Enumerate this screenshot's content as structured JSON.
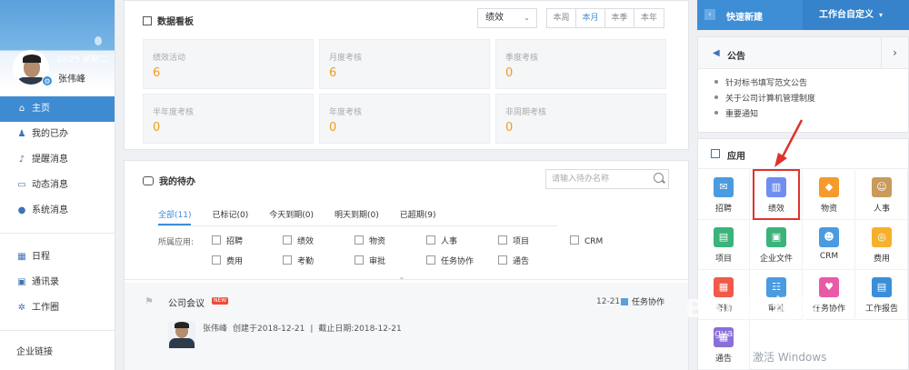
{
  "sidebar": {
    "date": "12/25 星期二",
    "user_name": "张伟峰",
    "items": [
      {
        "label": "主页",
        "icon": "home-icon",
        "active": true
      },
      {
        "label": "我的已办",
        "icon": "user-check-icon"
      },
      {
        "label": "提醒消息",
        "icon": "bell-icon"
      },
      {
        "label": "动态消息",
        "icon": "message-icon"
      },
      {
        "label": "系统消息",
        "icon": "info-icon"
      },
      {
        "label": "日程",
        "icon": "calendar-icon"
      },
      {
        "label": "通讯录",
        "icon": "contacts-icon"
      },
      {
        "label": "工作圈",
        "icon": "circle-icon"
      },
      {
        "label": "企业链接",
        "icon": ""
      }
    ]
  },
  "kanban": {
    "title": "数据看板",
    "select_value": "绩效",
    "periods": [
      "本周",
      "本月",
      "本季",
      "本年"
    ],
    "active_period": "本月",
    "cards": [
      {
        "label": "绩效活动",
        "value": "6"
      },
      {
        "label": "月度考核",
        "value": "6"
      },
      {
        "label": "季度考核",
        "value": "0"
      },
      {
        "label": "半年度考核",
        "value": "0"
      },
      {
        "label": "年度考核",
        "value": "0"
      },
      {
        "label": "非周期考核",
        "value": "0"
      }
    ]
  },
  "todo": {
    "title": "我的待办",
    "search_placeholder": "请输入待办名称",
    "tabs": [
      "全部(11)",
      "已标记(0)",
      "今天到期(0)",
      "明天到期(0)",
      "已超期(9)"
    ],
    "filter_label": "所属应用:",
    "filters": [
      "招聘",
      "绩效",
      "物资",
      "人事",
      "项目",
      "CRM",
      "费用",
      "考勤",
      "审批",
      "任务协作",
      "通告"
    ],
    "task": {
      "title": "公司会议",
      "badge": "NEW",
      "date": "12-21",
      "category": "任务协作",
      "author": "张伟峰",
      "created": "创建于2018-12-21",
      "deadline": "截止日期:2018-12-21",
      "separator": "|"
    }
  },
  "quick": {
    "new_label": "快速新建",
    "custom_label": "工作台自定义"
  },
  "notice": {
    "title": "公告",
    "items": [
      "针对标书填写范文公告",
      "关于公司计算机管理制度",
      "重要通知"
    ]
  },
  "apps": {
    "title": "应用",
    "items": [
      {
        "label": "招聘",
        "color": "#4a9be0"
      },
      {
        "label": "绩效",
        "color": "#6f8ef0"
      },
      {
        "label": "物资",
        "color": "#f59a2c"
      },
      {
        "label": "人事",
        "color": "#c99a5c"
      },
      {
        "label": "项目",
        "color": "#3bb37a"
      },
      {
        "label": "企业文件",
        "color": "#3bb37a"
      },
      {
        "label": "CRM",
        "color": "#4a9be0"
      },
      {
        "label": "费用",
        "color": "#f5b02c"
      },
      {
        "label": "考勤",
        "color": "#ef5a4a"
      },
      {
        "label": "审批",
        "color": "#4a9be0"
      },
      {
        "label": "任务协作",
        "color": "#e85aa8"
      },
      {
        "label": "工作报告",
        "color": "#3a8fd9"
      },
      {
        "label": "通告",
        "color": "#8a6fd8"
      }
    ]
  },
  "overlay": {
    "watermark": "Baidu经验",
    "watermark_url": "jingyan.baidu.com",
    "windows_text": "激活 Windows"
  }
}
